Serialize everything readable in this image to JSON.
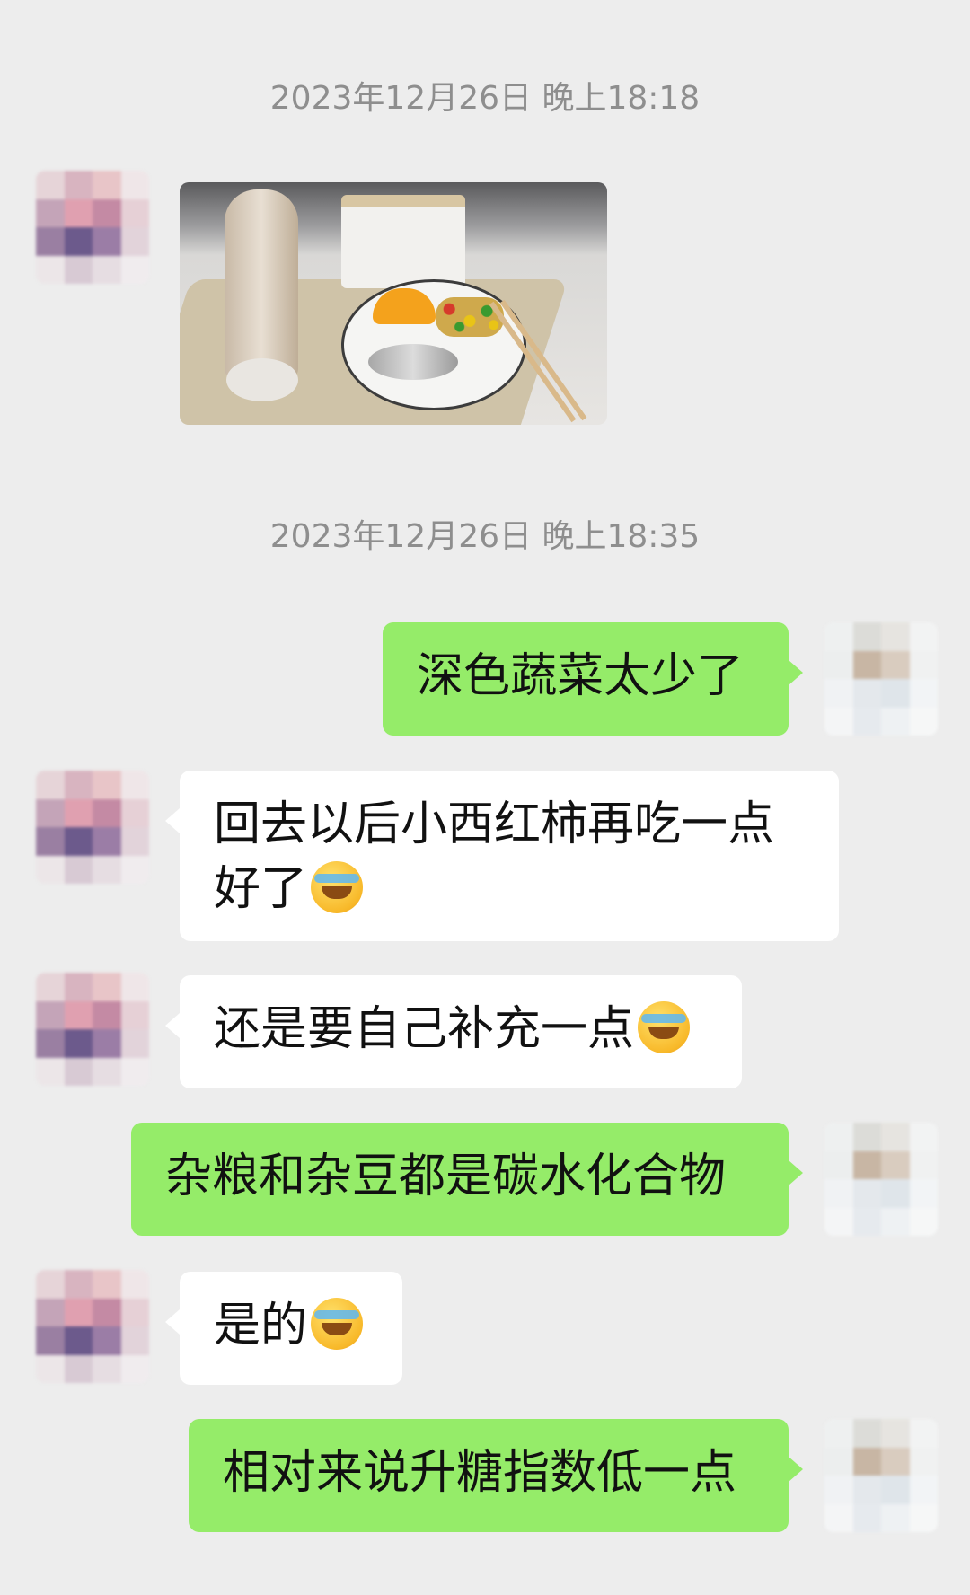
{
  "timestamps": [
    "2023年12月26日 晚上18:18",
    "2023年12月26日 晚上18:35"
  ],
  "messages": [
    {
      "text": "深色蔬菜太少了"
    },
    {
      "line1": "回去以后小西红柿再吃一点",
      "line2": "好了"
    },
    {
      "text": "还是要自己补充一点"
    },
    {
      "text": "杂粮和杂豆都是碳水化合物"
    },
    {
      "text": "是的"
    },
    {
      "text": "相对来说升糖指数低一点"
    }
  ],
  "emoji": "facepalm-crying-emoji",
  "colors": {
    "background": "#ededed",
    "self_bubble": "#95ec69",
    "other_bubble": "#ffffff",
    "timestamp": "#8e8e8e"
  }
}
